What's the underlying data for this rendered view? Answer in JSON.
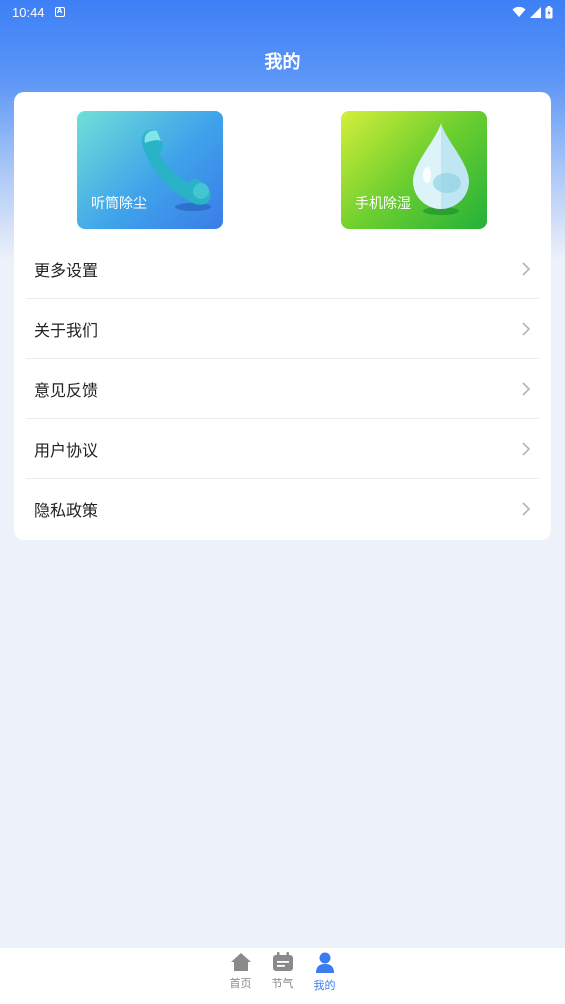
{
  "status_bar": {
    "time": "10:44"
  },
  "header": {
    "title": "我的"
  },
  "tiles": [
    {
      "label": "听筒除尘",
      "icon": "phone-receiver-icon"
    },
    {
      "label": "手机除湿",
      "icon": "water-drop-icon"
    }
  ],
  "menu": {
    "items": [
      {
        "label": "更多设置"
      },
      {
        "label": "关于我们"
      },
      {
        "label": "意见反馈"
      },
      {
        "label": "用户协议"
      },
      {
        "label": "隐私政策"
      }
    ]
  },
  "tabbar": {
    "tabs": [
      {
        "label": "首页",
        "icon": "home-icon"
      },
      {
        "label": "节气",
        "icon": "calendar-icon"
      },
      {
        "label": "我的",
        "icon": "user-icon",
        "active": true
      }
    ]
  },
  "colors": {
    "accent": "#3b7cf3",
    "background": "#edf1f9"
  }
}
